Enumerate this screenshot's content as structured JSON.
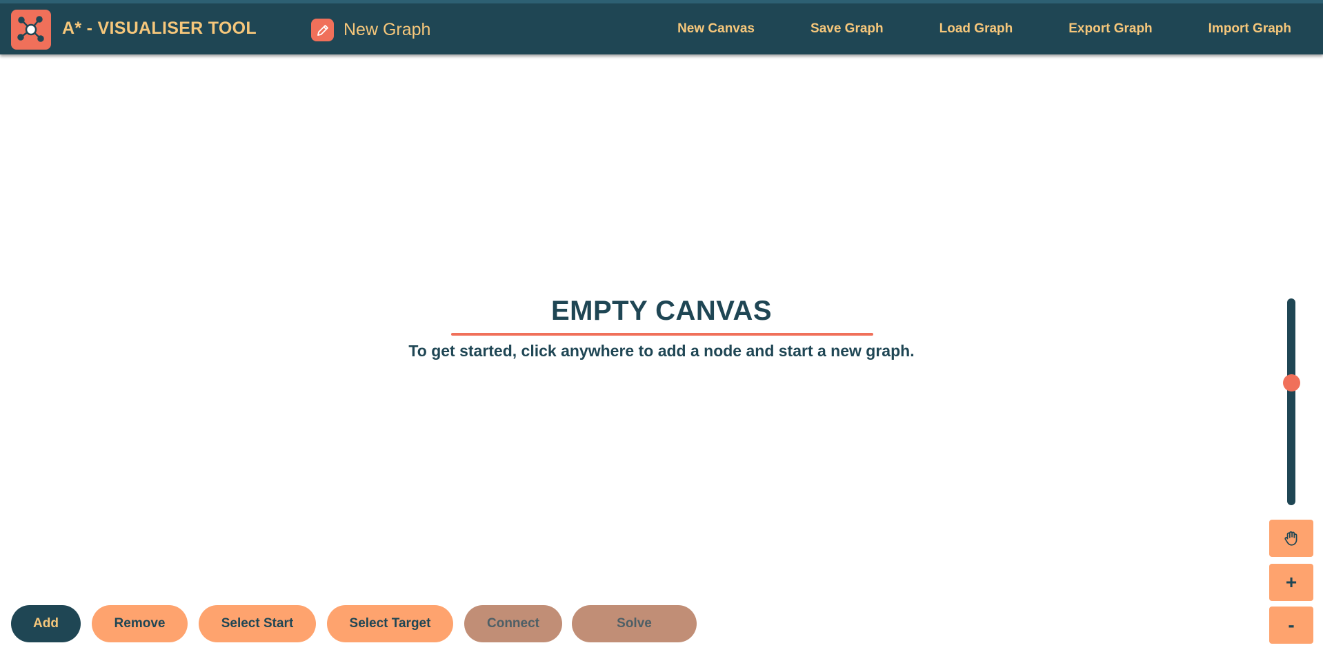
{
  "header": {
    "app_title": "A* - VISUALISER TOOL",
    "logo_icon": "graph-network-icon",
    "graph_name": "New Graph",
    "edit_icon": "pencil-icon",
    "nav": [
      "New Canvas",
      "Save Graph",
      "Load Graph",
      "Export Graph",
      "Import Graph"
    ]
  },
  "canvas": {
    "empty_title": "EMPTY CANVAS",
    "empty_subtitle": "To get started, click anywhere to add a node and start a new graph."
  },
  "zoom": {
    "level_fraction": 0.6,
    "pan_icon": "hand-icon",
    "zoom_in_label": "+",
    "zoom_out_label": "-"
  },
  "toolbar": {
    "add": "Add",
    "remove": "Remove",
    "select_start": "Select Start",
    "select_target": "Select Target",
    "connect": "Connect",
    "solve": "Solve",
    "active": "Add",
    "disabled": [
      "Connect",
      "Solve"
    ]
  },
  "colors": {
    "header_bg": "#1f4654",
    "accent": "#f0705a",
    "header_text": "#f6c77b",
    "button": "#fea36e",
    "button_disabled": "#c18e76"
  }
}
